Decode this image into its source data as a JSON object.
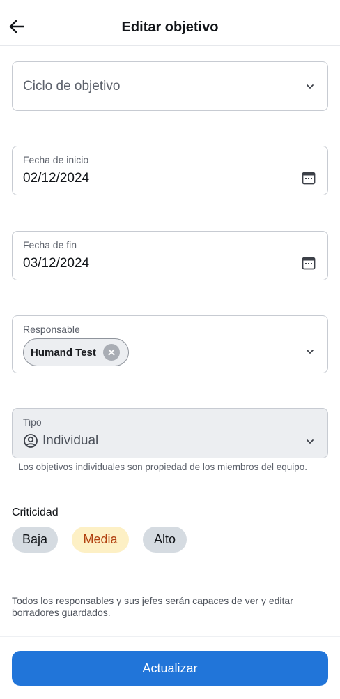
{
  "header": {
    "title": "Editar objetivo",
    "back_icon": "arrow-left-icon"
  },
  "form": {
    "ciclo": {
      "placeholder": "Ciclo de objetivo"
    },
    "fecha_inicio": {
      "label": "Fecha de inicio",
      "value": "02/12/2024"
    },
    "fecha_fin": {
      "label": "Fecha de fin",
      "value": "03/12/2024"
    },
    "responsable": {
      "label": "Responsable",
      "chip": "Humand Test"
    },
    "tipo": {
      "label": "Tipo",
      "value": "Individual",
      "helper": "Los objetivos individuales son propiedad de los miembros del equipo."
    },
    "criticidad": {
      "label": "Criticidad",
      "options": [
        "Baja",
        "Media",
        "Alto"
      ],
      "selected": "Media"
    },
    "note": "Todos los responsables y sus jefes serán capaces de ver y editar borradores guardados."
  },
  "footer": {
    "button_label": "Actualizar"
  },
  "colors": {
    "primary": "#2175d9",
    "selected_bg": "#fdf0c5",
    "selected_text": "#b1400f",
    "pill_bg": "#d5dbe1"
  }
}
